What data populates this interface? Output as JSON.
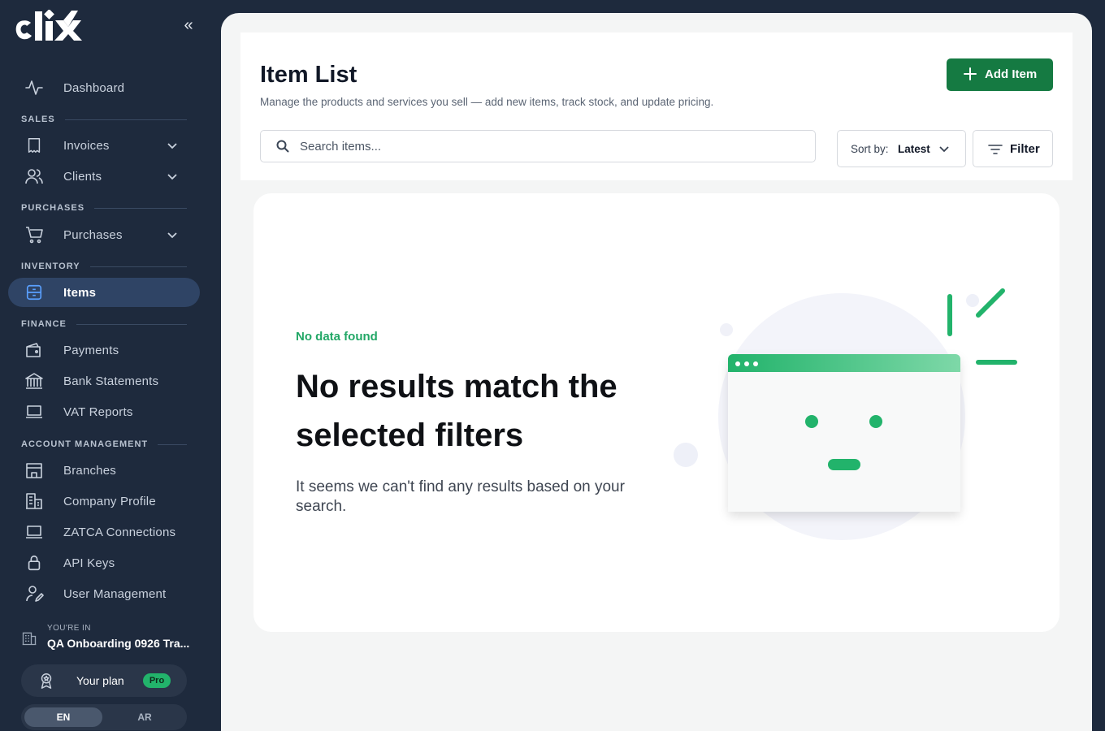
{
  "brand": {
    "logo_text": "clix"
  },
  "sidebar": {
    "collapse_icon": "double-chevron-left-icon",
    "dashboard": {
      "label": "Dashboard",
      "icon": "activity-icon"
    },
    "sections": {
      "sales": "SALES",
      "purchases": "PURCHASES",
      "inventory": "INVENTORY",
      "finance": "FINANCE",
      "account": "ACCOUNT MANAGEMENT"
    },
    "items": {
      "invoices": "Invoices",
      "clients": "Clients",
      "purchases": "Purchases",
      "items": "Items",
      "payments": "Payments",
      "bank_statements": "Bank Statements",
      "vat_reports": "VAT Reports",
      "branches": "Branches",
      "company_profile": "Company Profile",
      "zatca": "ZATCA Connections",
      "api_keys": "API Keys",
      "user_management": "User Management"
    },
    "active": "Items",
    "workspace": {
      "caption": "YOU'RE IN",
      "name": "QA Onboarding 0926 Tra..."
    },
    "plan": {
      "label": "Your plan",
      "badge": "Pro"
    },
    "language": {
      "en": "EN",
      "ar": "AR",
      "selected": "EN"
    }
  },
  "page": {
    "title": "Item List",
    "subtitle": "Manage the products and services you sell — add new items, track stock, and update pricing.",
    "add_button": "Add Item",
    "search_placeholder": "Search items...",
    "sort_label": "Sort by:",
    "sort_value": "Latest",
    "filter_label": "Filter"
  },
  "empty_state": {
    "label": "No data found",
    "title": "No results match the selected filters",
    "description": "It seems we can't find any results based on your search."
  },
  "colors": {
    "sidebar_bg": "#1e2a3d",
    "active_bg": "#2f4465",
    "accent_green": "#157a42",
    "empty_green": "#22a766",
    "pro_badge": "#22b36b"
  }
}
